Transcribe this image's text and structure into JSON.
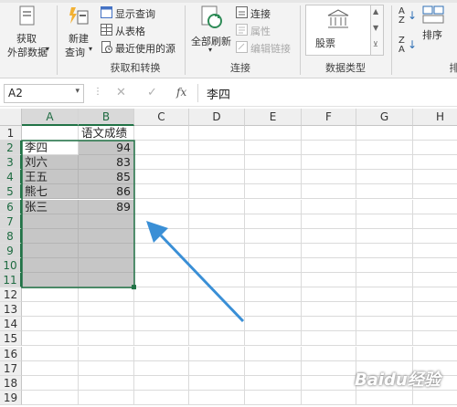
{
  "ribbon": {
    "get_external_data": [
      "获取",
      "外部数据"
    ],
    "new_query": [
      "新建",
      "查询"
    ],
    "show_queries": "显示查询",
    "from_table": "从表格",
    "recent_sources": "最近使用的源",
    "group_get_transform": "获取和转换",
    "refresh_all": "全部刷新",
    "connections": "连接",
    "properties": "属性",
    "edit_links": "编辑链接",
    "group_connections": "连接",
    "stocks": "股票",
    "group_data_types": "数据类型",
    "sort": "排序",
    "group_sort_partial": "排"
  },
  "formula_bar": {
    "name_box": "A2",
    "cancel": "✕",
    "enter": "✓",
    "fx": "fx",
    "content": "李四"
  },
  "columns": [
    "A",
    "B",
    "C",
    "D",
    "E",
    "F",
    "G",
    "H"
  ],
  "rows": [
    "1",
    "2",
    "3",
    "4",
    "5",
    "6",
    "7",
    "8",
    "9",
    "10",
    "11",
    "12",
    "13",
    "14",
    "15",
    "16",
    "17",
    "18",
    "19"
  ],
  "sheet": {
    "header_b1": "语文成绩",
    "names": [
      "李四",
      "刘六",
      "王五",
      "熊七",
      "张三"
    ],
    "scores": [
      "94",
      "83",
      "85",
      "86",
      "89"
    ]
  },
  "colors": {
    "accent": "#217346",
    "selection": "#c6c6c6",
    "arrow": "#3a8fd6"
  },
  "watermark": "Baidu经验"
}
